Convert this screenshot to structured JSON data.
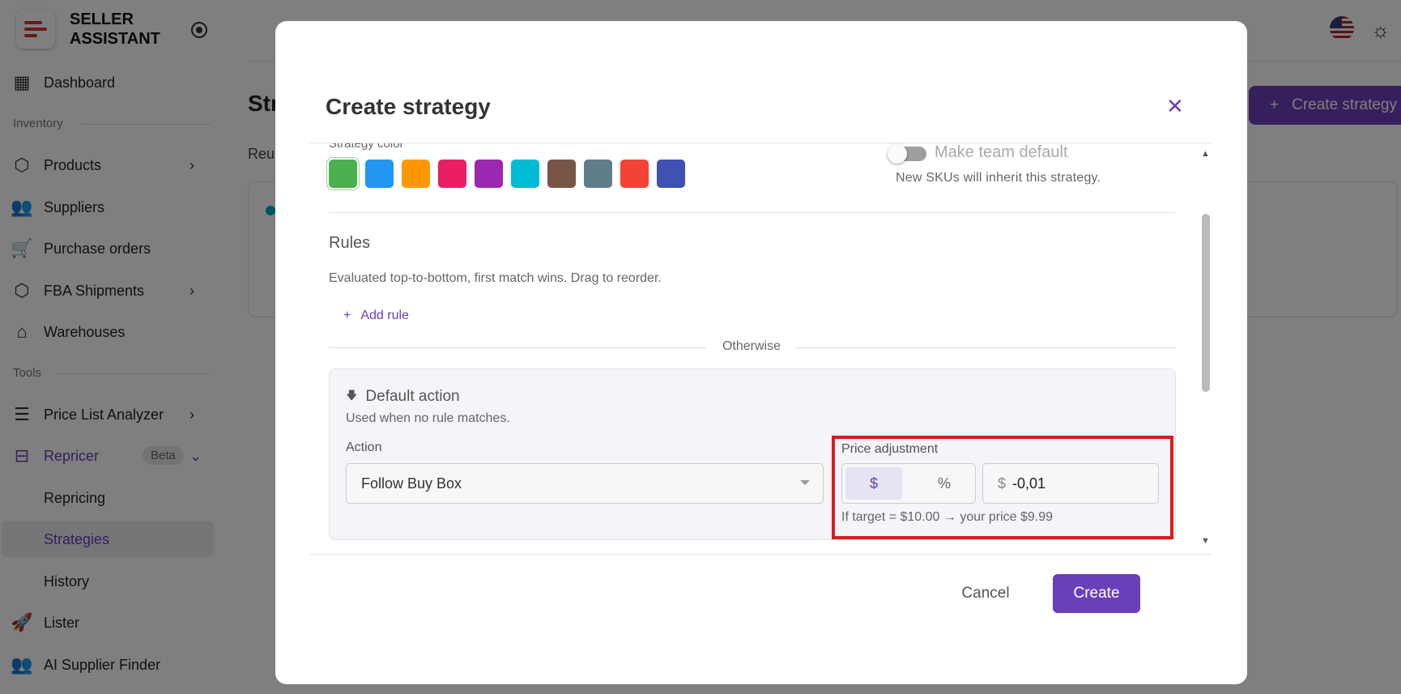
{
  "app": {
    "brand": "SELLER ASSISTANT"
  },
  "sidebar": {
    "dashboard": "Dashboard",
    "section_inventory": "Inventory",
    "products": "Products",
    "suppliers": "Suppliers",
    "purchase_orders": "Purchase orders",
    "fba_shipments": "FBA Shipments",
    "warehouses": "Warehouses",
    "section_tools": "Tools",
    "price_list_analyzer": "Price List Analyzer",
    "repricer": "Repricer",
    "repricer_badge": "Beta",
    "repricing": "Repricing",
    "strategies": "Strategies",
    "history": "History",
    "lister": "Lister",
    "ai_supplier_finder": "AI Supplier Finder"
  },
  "background": {
    "page_title": "Str",
    "page_sub": "Reu",
    "create_strategy_label": "Create strategy"
  },
  "modal": {
    "title": "Create strategy",
    "strategy_color_label": "Strategy color",
    "swatches": [
      "#4caf50",
      "#2196f3",
      "#ff9800",
      "#e91e63",
      "#9c27b0",
      "#00bcd4",
      "#795548",
      "#607d8b",
      "#f44336",
      "#3f51b5"
    ],
    "selected_swatch": "#4caf50",
    "team_default_label": "Make team default",
    "team_default_on": false,
    "team_default_hint": "New SKUs will inherit this strategy.",
    "rules_title": "Rules",
    "rules_hint": "Evaluated top-to-bottom, first match wins. Drag to reorder.",
    "add_rule_label": "Add rule",
    "otherwise_label": "Otherwise",
    "default_action": {
      "title": "Default action",
      "subtitle": "Used when no rule matches.",
      "action_label": "Action",
      "action_value": "Follow Buy Box",
      "price_adjustment_label": "Price adjustment",
      "unit_dollar": "$",
      "unit_percent": "%",
      "selected_unit": "$",
      "input_prefix": "$",
      "input_value": "-0,01",
      "hint": "If target = $10.00 → your price $9.99"
    },
    "cancel_label": "Cancel",
    "create_label": "Create"
  },
  "colors": {
    "accent": "#6a3fb8",
    "highlight_border": "#e0181e"
  }
}
